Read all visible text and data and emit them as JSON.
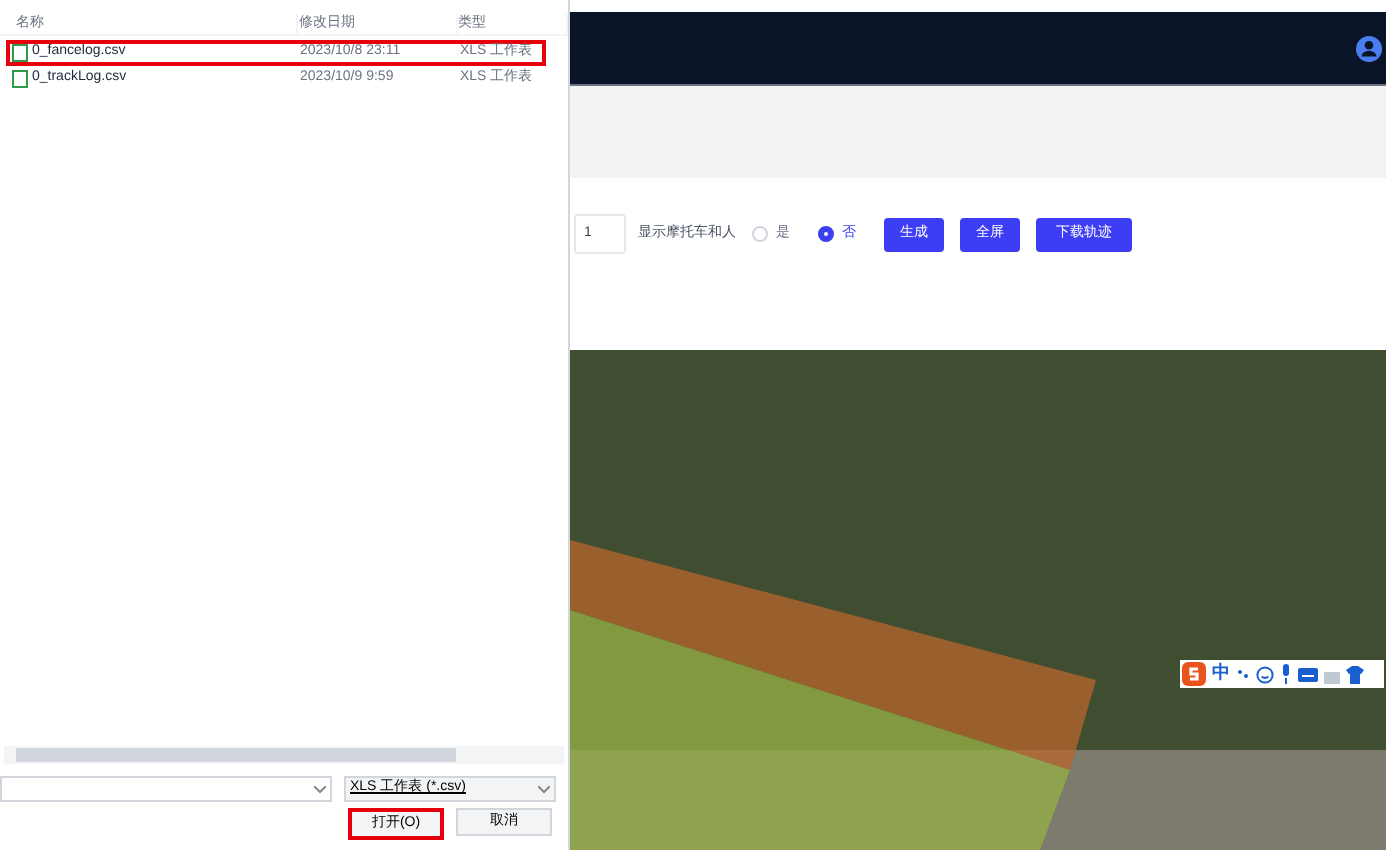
{
  "file_dialog": {
    "columns": [
      "名称",
      "修改日期",
      "类型"
    ],
    "files": [
      {
        "name": "0_fancelog.csv",
        "modified": "2023/10/8 23:11",
        "type": "XLS 工作表",
        "selected": true
      },
      {
        "name": "0_trackLog.csv",
        "modified": "2023/10/9 9:59",
        "type": "XLS 工作表",
        "selected": false
      }
    ],
    "file_type": "XLS 工作表 (*.csv)",
    "buttons": [
      {
        "label": "打开(O)",
        "primary": true
      },
      {
        "label": "取消",
        "primary": false
      }
    ]
  },
  "toolbar": {
    "count_value": "1",
    "show_label": "显示摩托车和人",
    "options": [
      {
        "label": "是",
        "selected": false
      },
      {
        "label": "否",
        "selected": true
      }
    ],
    "buttons": [
      "生成",
      "全屏",
      "下载轨迹"
    ]
  },
  "ime_bar": {
    "mode": "中"
  }
}
